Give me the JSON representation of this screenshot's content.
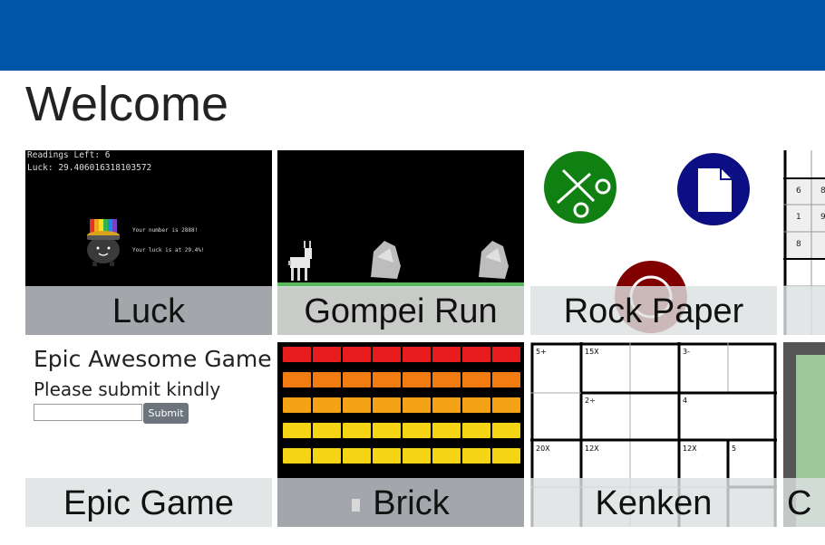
{
  "page": {
    "title": "Welcome"
  },
  "colors": {
    "topbar": "#0055a8",
    "scissors_circle": "#118012",
    "paper_circle": "#0c0f84",
    "rock_circle": "#800000"
  },
  "tiles": [
    {
      "label": "Luck"
    },
    {
      "label": "Gompei Run"
    },
    {
      "label": "Rock Paper"
    },
    {
      "label": ""
    },
    {
      "label": "Epic Game"
    },
    {
      "label": "Brick"
    },
    {
      "label": "Kenken"
    },
    {
      "label": "C"
    }
  ],
  "luck": {
    "readings": "Readings Left: 6",
    "luck_value": "Luck: 29.406016318103572",
    "number_msg": "Your number is 2888!",
    "luck_msg": "Your luck is at 29.4%!"
  },
  "epic": {
    "heading": "Epic Awesome Game",
    "subheading": "Please submit kindly",
    "submit_label": "Submit",
    "input_value": ""
  },
  "kenken": {
    "cages": [
      "5+",
      "15X",
      "3-",
      "2÷",
      "4",
      "20X",
      "12X",
      "12X",
      "5"
    ]
  },
  "sudoku": {
    "visible_digits": [
      "6",
      "8",
      "1",
      "9",
      "8"
    ]
  }
}
